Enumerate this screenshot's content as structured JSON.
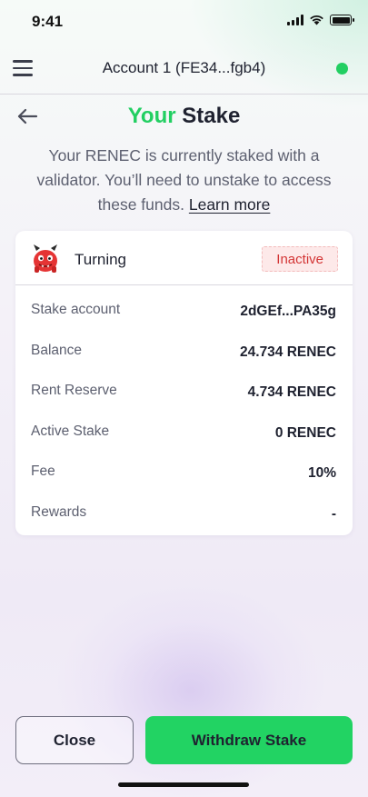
{
  "status_bar": {
    "time": "9:41"
  },
  "header": {
    "account_name": "Account 1 (FE34...fgb4)",
    "connection_color": "#22cf62"
  },
  "page": {
    "title_highlight": "Your",
    "title_rest": "Stake"
  },
  "description": {
    "text": "Your RENEC is currently staked with a validator. You’ll need to unstake to access these funds.",
    "link": "Learn more"
  },
  "validator": {
    "name": "Turning",
    "status": "Inactive",
    "avatar_icon": "red-monster-icon"
  },
  "details": [
    {
      "label": "Stake account",
      "value": "2dGEf...PA35g"
    },
    {
      "label": "Balance",
      "value": "24.734 RENEC"
    },
    {
      "label": "Rent Reserve",
      "value": "4.734 RENEC"
    },
    {
      "label": "Active Stake",
      "value": "0 RENEC"
    },
    {
      "label": "Fee",
      "value": "10%"
    },
    {
      "label": "Rewards",
      "value": "-"
    }
  ],
  "buttons": {
    "close": "Close",
    "withdraw": "Withdraw Stake"
  },
  "colors": {
    "accent": "#22cf62",
    "inactive_text": "#d33535",
    "inactive_bg": "#fde9e9"
  }
}
